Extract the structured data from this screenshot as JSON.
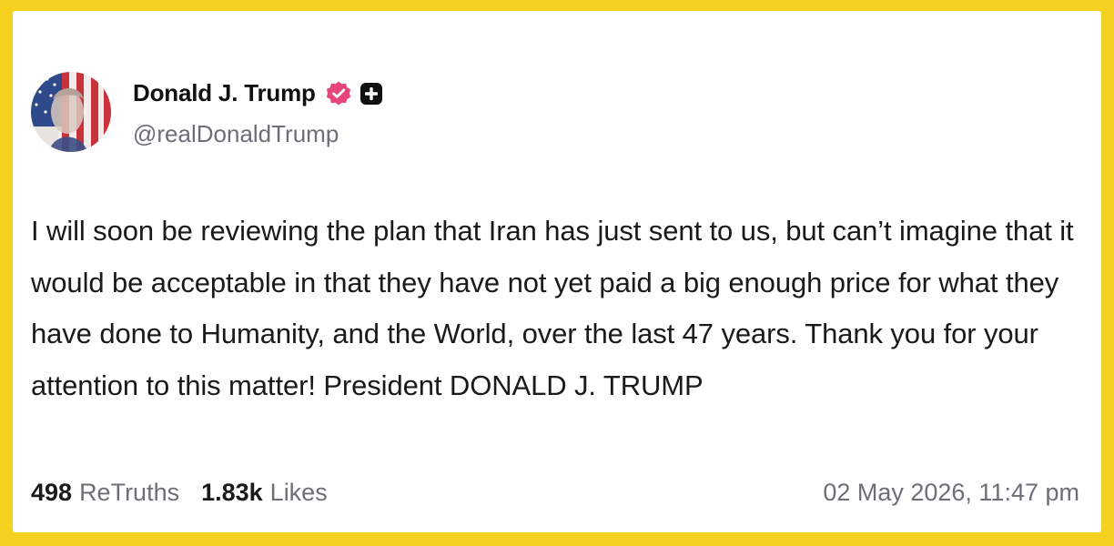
{
  "post": {
    "author": {
      "display_name": "Donald J. Trump",
      "handle": "@realDonaldTrump",
      "verified_icon": "verified-badge-icon",
      "extra_icon": "plus-badge-icon",
      "verified_color": "#e8457c"
    },
    "body": "I will soon be reviewing the plan that Iran has just sent to us, but can’t imagine that it would be acceptable in that they have not yet paid a big enough price for what they have done to Humanity, and the World, over the last 47 years. Thank you for your attention to this matter! President DONALD J. TRUMP",
    "retruths_count": "498",
    "retruths_label": "ReTruths",
    "likes_count": "1.83k",
    "likes_label": "Likes",
    "timestamp": "02 May 2026, 11:47 pm"
  },
  "colors": {
    "frame": "#f4d21f",
    "card": "#ffffff",
    "secondary_text": "#6b6f76"
  }
}
